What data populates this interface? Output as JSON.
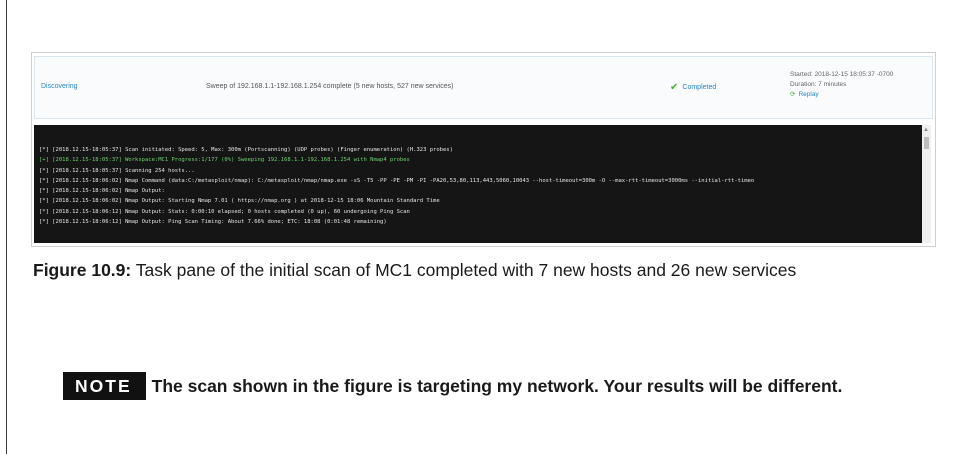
{
  "task": {
    "status": "Discovering",
    "description": "Sweep of 192.168.1.1-192.168.1.254 complete (5 new hosts, 527 new services)",
    "completed_label": "Completed",
    "started": "Started: 2018-12-15 18:05:37 -0700",
    "duration": "Duration: 7 minutes",
    "replay": "Replay"
  },
  "console": {
    "lines": [
      {
        "text": "[*] [2018.12.15-18:05:37] Scan initiated: Speed: 5, Max: 300m (Portscanning) (UDP probes) (Finger enumeration) (H.323 probes)",
        "green": false
      },
      {
        "text": "[+] [2018.12.15-18:05:37] Workspace:MC1 Progress:1/177 (0%) Sweeping 192.168.1.1-192.168.1.254 with Nmap4 probes",
        "green": true
      },
      {
        "text": "[*] [2018.12.15-18:05:37] Scanning 254 hosts...",
        "green": false
      },
      {
        "text": "[*] [2018.12.15-18:06:02] Nmap Command (data:C:/metasploit/nmap): C:/metasploit/nmap/nmap.exe -sS -T5 -PP -PE -PM -PI -PA20,53,80,113,443,5060,10043 --host-timeout=300m -O --max-rtt-timeout=3000ms --initial-rtt-timeo",
        "green": false
      },
      {
        "text": "[*] [2018.12.15-18:06:02] Nmap Output:",
        "green": false
      },
      {
        "text": "[*] [2018.12.15-18:06:02] Nmap Output: Starting Nmap 7.01 ( https://nmap.org ) at 2018-12-15 18:06 Mountain Standard Time",
        "green": false
      },
      {
        "text": "[*] [2018.12.15-18:06:12] Nmap Output: Stats: 0:00:10 elapsed; 0 hosts completed (0 up), 60 undergoing Ping Scan",
        "green": false
      },
      {
        "text": "[*] [2018.12.15-18:06:12] Nmap Output: Ping Scan Timing: About 7.66% done; ETC: 18:08 (0:01:48 remaining)",
        "green": false
      }
    ]
  },
  "caption": {
    "label": "Figure 10.9:",
    "text": " Task pane of the initial scan of MC1 completed with 7 new hosts and 26 new services"
  },
  "note": {
    "tag": "NOTE",
    "text": "The scan shown in the figure is targeting my network. Your results will be different."
  },
  "colors": {
    "link": "#2a86c9",
    "success": "#4cae3a",
    "console_bg": "#151515",
    "console_green": "#6fd36f"
  }
}
